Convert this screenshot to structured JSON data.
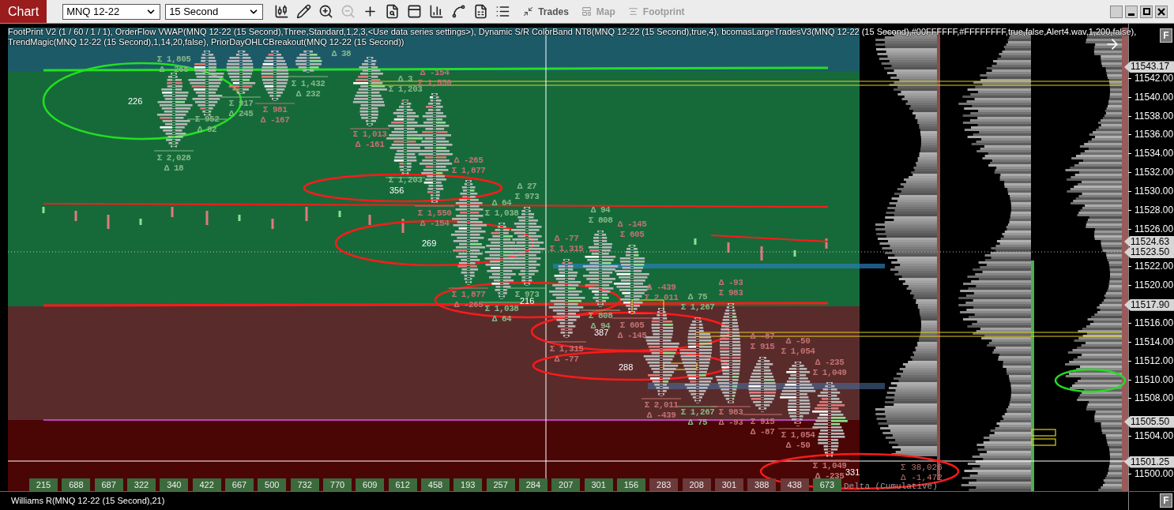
{
  "toolbar": {
    "chart_tab": "Chart",
    "instrument": {
      "value": "MNQ 12-22"
    },
    "interval": {
      "value": "15 Second"
    },
    "tools": [
      {
        "kind": "candles",
        "disabled": false
      },
      {
        "kind": "pencil",
        "disabled": false
      },
      {
        "kind": "zoom_in",
        "disabled": false
      },
      {
        "kind": "zoom_out",
        "disabled": true
      },
      {
        "kind": "crosshair",
        "disabled": false
      },
      {
        "kind": "data_box",
        "disabled": false
      },
      {
        "kind": "templates",
        "disabled": false
      },
      {
        "kind": "indicators",
        "disabled": false
      },
      {
        "kind": "strategies",
        "disabled": false
      },
      {
        "kind": "properties",
        "disabled": false
      },
      {
        "kind": "list",
        "disabled": false
      }
    ],
    "text_buttons": [
      {
        "label": "Trades",
        "kind": "trades",
        "disabled": false
      },
      {
        "label": "Map",
        "kind": "map",
        "disabled": true
      },
      {
        "label": "Footprint",
        "kind": "footprint",
        "disabled": true
      }
    ]
  },
  "indicator_lines": [
    "FootPrint V2 (1 / 60 / 1 / 1), OrderFlow VWAP(MNQ 12-22 (15 Second),Three,Standard,1,2,3,<Use data series settings>), Dynamic S/R ColorBand NT8(MNQ 12-22 (15 Second),true,4), bcomasLargeTradesV3(MNQ 12-22 (15 Second),#00FFFFFF,#FFFFFFFF,true,false,Alert4.wav,1,200,false),",
    "TrendMagic(MNQ 12-22 (15 Second),1,14,20,false), PriorDayOHLCBreakout(MNQ 12-22 (15 Second))"
  ],
  "footprint_columns": [
    {
      "color": "#86b886",
      "top": [
        "Σ 1,805",
        "Δ -265"
      ],
      "bottom": [
        "Σ 2,028",
        "Δ 18"
      ]
    },
    {
      "color": "#86b886",
      "bottom": [
        "Σ 952",
        "Δ 82"
      ]
    },
    {
      "color": "#86b886",
      "bottom": [
        "Σ 917",
        "Δ 245"
      ]
    },
    {
      "color": "#c27272",
      "bottom": [
        "Σ 981",
        "Δ -167"
      ]
    },
    {
      "color": "#86b886",
      "bottom": [
        "Σ 1,432",
        "Δ 232"
      ]
    },
    {
      "color": "#86b886",
      "top": [
        "Δ 38"
      ]
    },
    {
      "color": "#c27272",
      "bottom": [
        "Σ 1,013",
        "Δ -161"
      ]
    },
    {
      "color": "#86b886",
      "top": [
        "Δ 3",
        "Σ 1,203"
      ],
      "bottom": [
        "Σ 1,203"
      ]
    },
    {
      "color": "#c27272",
      "top": [
        "Δ -154",
        "Σ 1,550"
      ],
      "bottom": [
        "Σ 1,550",
        "Δ -154"
      ]
    },
    {
      "color": "#c27272",
      "top": [
        "Δ -265",
        "Σ 1,877"
      ],
      "bottom": [
        "Σ 1,877",
        "Δ -265"
      ]
    },
    {
      "color": "#86b886",
      "top": [
        "Δ 64",
        "Σ 1,038"
      ],
      "bottom": [
        "Σ 1,038",
        "Δ 64"
      ]
    },
    {
      "color": "#86b886",
      "top": [
        "Δ 27",
        "Σ 973"
      ],
      "bottom": [
        "Σ 973"
      ]
    },
    {
      "color": "#c27272",
      "top": [
        "Δ -77",
        "Σ 1,315"
      ],
      "bottom": [
        "Σ 1,315",
        "Δ -77"
      ]
    },
    {
      "color": "#86b886",
      "top": [
        "Δ 94",
        "Σ 808"
      ],
      "bottom": [
        "Σ 808",
        "Δ 94"
      ]
    },
    {
      "color": "#c27272",
      "top": [
        "Δ -145",
        "Σ 605"
      ],
      "bottom": [
        "Σ 605",
        "Δ -145"
      ]
    },
    {
      "color": "#c27272",
      "top": [
        "Δ -439",
        "Σ 2,011"
      ],
      "bottom": [
        "Σ 2,011",
        "Δ -439"
      ]
    },
    {
      "color": "#86b886",
      "top": [
        "Δ 75",
        "Σ 1,267"
      ],
      "bottom": [
        "Σ 1,267",
        "Δ 75"
      ]
    },
    {
      "color": "#c27272",
      "top": [
        "Δ -93",
        "Σ 983"
      ],
      "bottom": [
        "Σ 983",
        "Δ -93"
      ]
    },
    {
      "color": "#c27272",
      "top": [
        "Δ -87",
        "Σ 915"
      ],
      "bottom": [
        "Σ 915",
        "Δ -87"
      ]
    },
    {
      "color": "#c27272",
      "top": [
        "Δ -50",
        "Σ 1,054"
      ],
      "bottom": [
        "Σ 1,054",
        "Δ -50"
      ]
    },
    {
      "color": "#c27272",
      "top": [
        "Δ -235",
        "Σ 1,049"
      ],
      "bottom": [
        "Σ 1,049",
        "Δ -235"
      ]
    }
  ],
  "annotations": [
    {
      "label": "226",
      "color": "#22e022"
    },
    {
      "label": "356",
      "color": "#ff1a1a"
    },
    {
      "label": "269",
      "color": "#ff1a1a"
    },
    {
      "label": "216",
      "color": "#ff1a1a"
    },
    {
      "label": "387",
      "color": "#ff1a1a"
    },
    {
      "label": "288",
      "color": "#ff1a1a"
    },
    {
      "label": "331",
      "color": "#ff1a1a"
    }
  ],
  "delta_row": {
    "cells": [
      {
        "value": "215",
        "color": "#3c6a3c"
      },
      {
        "value": "688",
        "color": "#3c6a3c"
      },
      {
        "value": "687",
        "color": "#3c6a3c"
      },
      {
        "value": "322",
        "color": "#3c6a3c"
      },
      {
        "value": "340",
        "color": "#3c6a3c"
      },
      {
        "value": "422",
        "color": "#3c6a3c"
      },
      {
        "value": "667",
        "color": "#3c6a3c"
      },
      {
        "value": "500",
        "color": "#3c6a3c"
      },
      {
        "value": "732",
        "color": "#3c6a3c"
      },
      {
        "value": "770",
        "color": "#3c6a3c"
      },
      {
        "value": "609",
        "color": "#3c6a3c"
      },
      {
        "value": "612",
        "color": "#3c6a3c"
      },
      {
        "value": "458",
        "color": "#3c6a3c"
      },
      {
        "value": "193",
        "color": "#3c6a3c"
      },
      {
        "value": "257",
        "color": "#3c6a3c"
      },
      {
        "value": "284",
        "color": "#3c6a3c"
      },
      {
        "value": "207",
        "color": "#3c6a3c"
      },
      {
        "value": "301",
        "color": "#3c6a3c"
      },
      {
        "value": "156",
        "color": "#3c6a3c"
      },
      {
        "value": "283",
        "color": "#6b3a3a"
      },
      {
        "value": "208",
        "color": "#6b3a3a"
      },
      {
        "value": "301",
        "color": "#6b3a3a"
      },
      {
        "value": "388",
        "color": "#6b3a3a"
      },
      {
        "value": "438",
        "color": "#6b3a3a"
      },
      {
        "value": "673",
        "color": "#3c6a3c"
      }
    ],
    "caption": "Delta (Cumulative)",
    "total_volume": "Σ 38,026",
    "total_delta": "Δ -1,472"
  },
  "price_axis": [
    {
      "label": "11543.17",
      "kind": "marker"
    },
    {
      "label": "11542.00",
      "kind": "tick"
    },
    {
      "label": "11540.00",
      "kind": "tick"
    },
    {
      "label": "11538.00",
      "kind": "tick"
    },
    {
      "label": "11536.00",
      "kind": "tick"
    },
    {
      "label": "11534.00",
      "kind": "tick"
    },
    {
      "label": "11532.00",
      "kind": "tick"
    },
    {
      "label": "11530.00",
      "kind": "tick"
    },
    {
      "label": "11528.00",
      "kind": "tick"
    },
    {
      "label": "11526.00",
      "kind": "tick"
    },
    {
      "label": "11524.63",
      "kind": "marker"
    },
    {
      "label": "11523.50",
      "kind": "marker"
    },
    {
      "label": "11522.00",
      "kind": "tick"
    },
    {
      "label": "11520.00",
      "kind": "tick"
    },
    {
      "label": "11517.90",
      "kind": "marker"
    },
    {
      "label": "11516.00",
      "kind": "tick"
    },
    {
      "label": "11514.00",
      "kind": "tick"
    },
    {
      "label": "11512.00",
      "kind": "tick"
    },
    {
      "label": "11510.00",
      "kind": "tick"
    },
    {
      "label": "11508.00",
      "kind": "tick"
    },
    {
      "label": "11505.50",
      "kind": "marker"
    },
    {
      "label": "11504.00",
      "kind": "tick"
    },
    {
      "label": "11501.25",
      "kind": "marker"
    },
    {
      "label": "11500.00",
      "kind": "tick"
    }
  ],
  "panel_buttons": [
    "F",
    "F"
  ],
  "lower_panel": {
    "title": "Williams R(MNQ 12-22 (15 Second),21)"
  }
}
